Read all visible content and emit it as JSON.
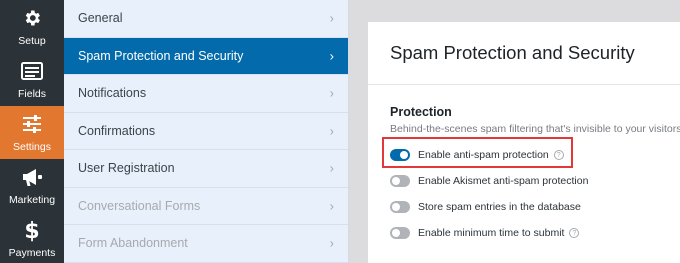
{
  "rail": {
    "items": [
      {
        "label": "Setup",
        "icon": "gear-icon"
      },
      {
        "label": "Fields",
        "icon": "fields-list-icon"
      },
      {
        "label": "Settings",
        "icon": "sliders-icon",
        "active": true
      },
      {
        "label": "Marketing",
        "icon": "megaphone-icon"
      },
      {
        "label": "Payments",
        "icon": "dollar-icon"
      }
    ]
  },
  "submenu": {
    "items": [
      {
        "label": "General"
      },
      {
        "label": "Spam Protection and Security",
        "active": true
      },
      {
        "label": "Notifications"
      },
      {
        "label": "Confirmations"
      },
      {
        "label": "User Registration"
      },
      {
        "label": "Conversational Forms",
        "disabled": true
      },
      {
        "label": "Form Abandonment",
        "disabled": true
      }
    ]
  },
  "panel": {
    "title": "Spam Protection and Security",
    "section_title": "Protection",
    "section_desc": "Behind-the-scenes spam filtering that's invisible to your visitors.",
    "toggles": [
      {
        "label": "Enable anti-spam protection",
        "on": true,
        "help": true
      },
      {
        "label": "Enable Akismet anti-spam protection",
        "on": false,
        "help": false
      },
      {
        "label": "Store spam entries in the database",
        "on": false,
        "help": false
      },
      {
        "label": "Enable minimum time to submit",
        "on": false,
        "help": true
      }
    ]
  },
  "colors": {
    "rail_bg": "#2c3338",
    "accent_orange": "#e27730",
    "active_blue": "#036aab",
    "submenu_bg": "#e8f0fb",
    "highlight_red": "#e3383a"
  }
}
